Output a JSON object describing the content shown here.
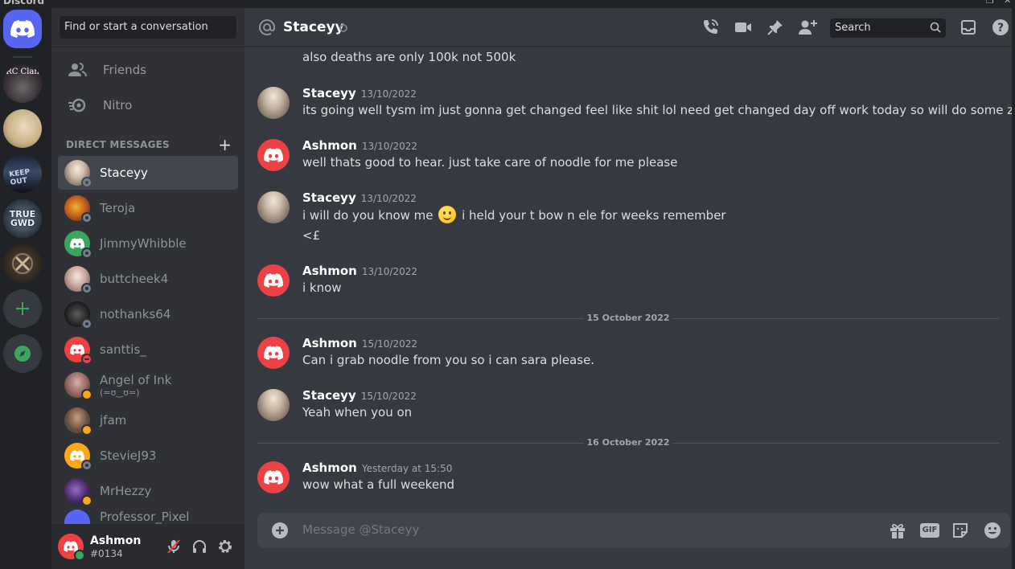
{
  "window": {
    "title": "Discord",
    "restore_glyph": "❐",
    "close_glyph": "✕"
  },
  "servers": {
    "home_icon": "discord-logo-icon",
    "items": [
      {
        "name": "RC Clan",
        "label": "RC Clan"
      },
      {
        "name": "portrait-server"
      },
      {
        "name": "keep-out-server",
        "label": "KEEP OUT"
      },
      {
        "name": "true-gwd-server",
        "label_top": "TRUE",
        "label_bottom": "GWD"
      },
      {
        "name": "crossed-swords-server"
      }
    ],
    "add_icon": "plus-icon",
    "explore_icon": "compass-icon",
    "colors": {
      "home": "#5865f2",
      "green": "#3ba55d"
    }
  },
  "sidebar": {
    "search_placeholder": "Find or start a conversation",
    "nav": [
      {
        "label": "Friends",
        "icon": "friends-icon"
      },
      {
        "label": "Nitro",
        "icon": "nitro-icon"
      }
    ],
    "dm_header": "DIRECT MESSAGES",
    "dm_add": "+",
    "dms": [
      {
        "name": "Staceyy",
        "status": "offline",
        "active": true
      },
      {
        "name": "Teroja",
        "status": "offline"
      },
      {
        "name": "JimmyWhibble",
        "status": "offline"
      },
      {
        "name": "buttcheek4",
        "status": "offline"
      },
      {
        "name": "nothanks64",
        "status": "offline"
      },
      {
        "name": "santtis_",
        "status": "dnd"
      },
      {
        "name": "Angel of Ink",
        "sub": "(=ʊ‿ʊ=)",
        "status": "idle"
      },
      {
        "name": "jfam",
        "status": "idle"
      },
      {
        "name": "StevieJ93",
        "status": "offline"
      },
      {
        "name": "MrHezzy",
        "status": "idle"
      },
      {
        "name": "Professor_Pixel"
      }
    ]
  },
  "user": {
    "name": "Ashmon",
    "tag": "#0134",
    "status": "online"
  },
  "chat": {
    "header": {
      "name": "Staceyy",
      "search_placeholder": "Search"
    },
    "continuation": "also deaths are only 100k not 500k",
    "messages": [
      {
        "author": "Staceyy",
        "time": "13/10/2022",
        "lines": [
          "its going well tysm im just gonna get changed feel like shit lol need get changed day off work today so will do some zulrah"
        ]
      },
      {
        "author": "Ashmon",
        "time": "13/10/2022",
        "lines": [
          "well thats good to hear. just take care of noodle for me please"
        ]
      },
      {
        "author": "Staceyy",
        "time": "13/10/2022",
        "lines": [
          "i will do you know me",
          "i held your t bow n ele for weeks remember",
          "<£"
        ]
      },
      {
        "author": "Ashmon",
        "time": "13/10/2022",
        "lines": [
          "i know"
        ]
      },
      {
        "author": "Ashmon",
        "time": "15/10/2022",
        "lines": [
          "Can i grab noodle from you so i can sara please."
        ]
      },
      {
        "author": "Staceyy",
        "time": "15/10/2022",
        "lines": [
          "Yeah when you on"
        ]
      },
      {
        "author": "Ashmon",
        "time": "Yesterday at 15:50",
        "lines": [
          "wow what a full weekend"
        ]
      }
    ],
    "dividers": [
      "15 October 2022",
      "16 October 2022"
    ],
    "composer_placeholder": "Message @Staceyy",
    "composer_gif": "GIF"
  }
}
